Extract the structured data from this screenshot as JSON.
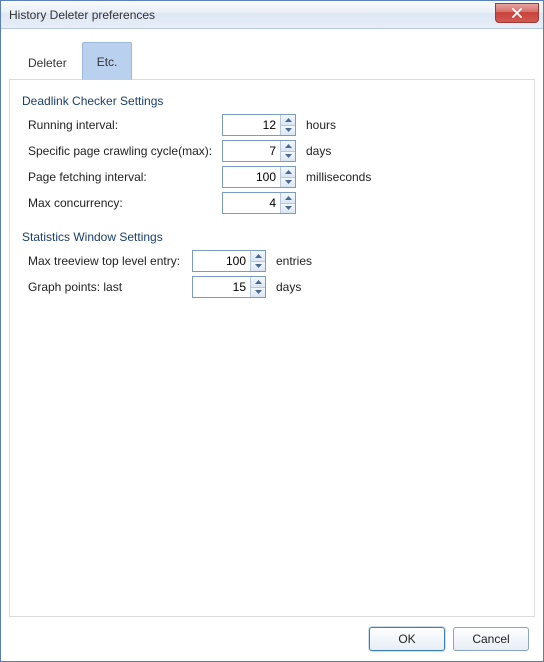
{
  "window": {
    "title": "History Deleter preferences"
  },
  "tabs": [
    {
      "label": "Deleter",
      "active": false
    },
    {
      "label": "Etc.",
      "active": true
    }
  ],
  "deadlink": {
    "heading": "Deadlink Checker Settings",
    "rows": [
      {
        "label": "Running interval:",
        "value": "12",
        "unit": "hours"
      },
      {
        "label": "Specific page crawling cycle(max):",
        "value": "7",
        "unit": "days"
      },
      {
        "label": "Page fetching interval:",
        "value": "100",
        "unit": "milliseconds"
      },
      {
        "label": "Max concurrency:",
        "value": "4",
        "unit": ""
      }
    ]
  },
  "stats": {
    "heading": "Statistics Window Settings",
    "rows": [
      {
        "label": "Max treeview top level entry:",
        "value": "100",
        "unit": "entries"
      },
      {
        "label": "Graph points: last",
        "value": "15",
        "unit": "days"
      }
    ]
  },
  "buttons": {
    "ok": "OK",
    "cancel": "Cancel"
  }
}
